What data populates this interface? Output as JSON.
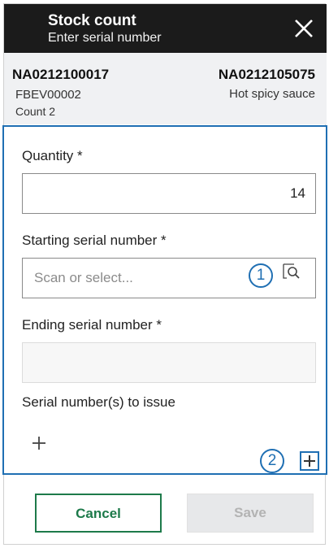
{
  "header": {
    "title": "Stock count",
    "subtitle": "Enter serial number"
  },
  "summary": {
    "item_id": "NA0212100017",
    "item_code": "FBEV00002",
    "count_label": "Count 2",
    "product_id": "NA0212105075",
    "product_desc": "Hot spicy sauce"
  },
  "form": {
    "quantity_label": "Quantity *",
    "quantity_value": "14",
    "start_serial_label": "Starting serial number *",
    "start_serial_placeholder": "Scan or select...",
    "end_serial_label": "Ending serial number *",
    "end_serial_value": "",
    "issue_label": "Serial number(s) to issue"
  },
  "markers": {
    "one": "1",
    "two": "2"
  },
  "footer": {
    "cancel_label": "Cancel",
    "save_label": "Save"
  },
  "colors": {
    "header_bg": "#1b1b1b",
    "highlight_blue": "#1f6fb3",
    "cancel_green": "#1d7a4a",
    "save_disabled_bg": "#e7e8ea"
  },
  "icons": {
    "close": "close-icon",
    "lookup": "lookup-search-icon",
    "add": "plus-icon",
    "add_boxed": "plus-box-icon"
  }
}
